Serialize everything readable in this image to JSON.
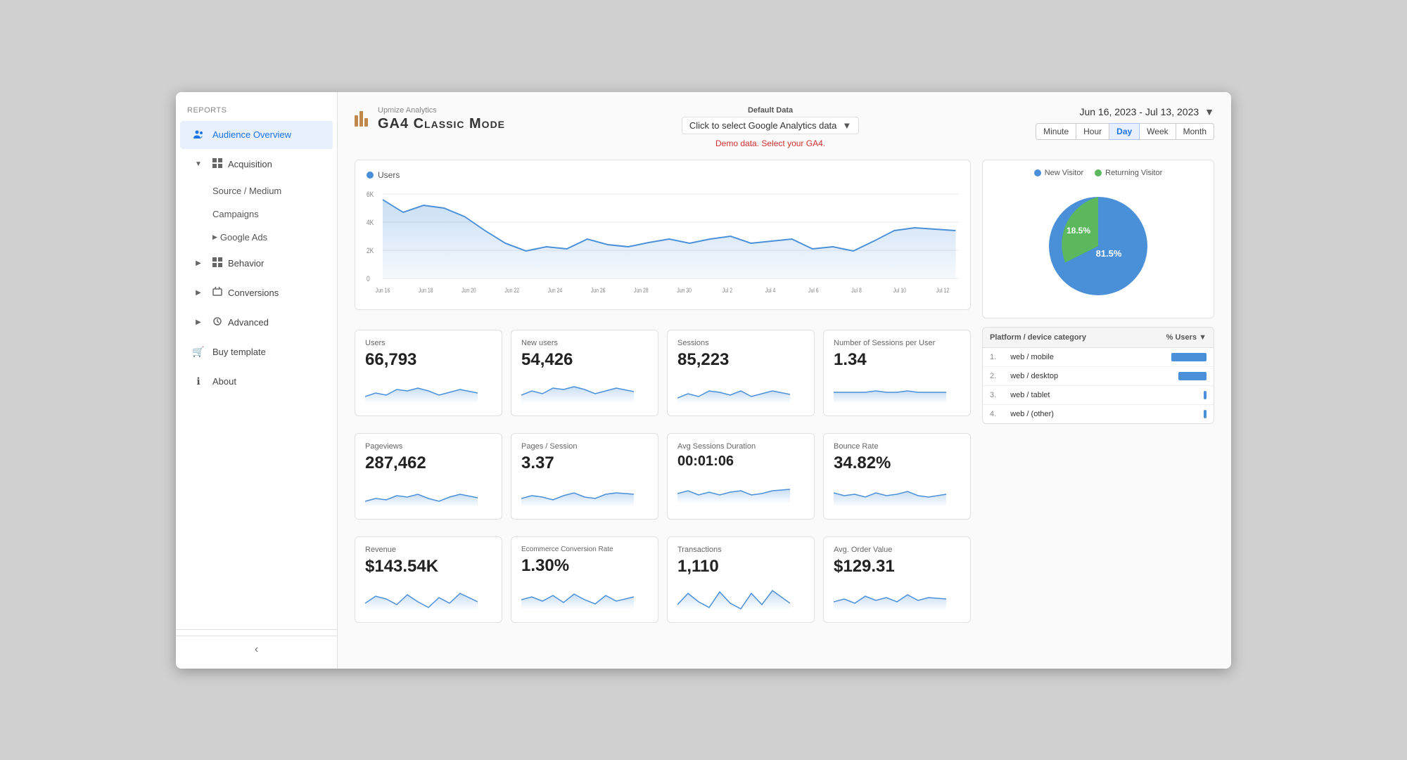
{
  "sidebar": {
    "reports_label": "Reports",
    "items": [
      {
        "id": "audience-overview",
        "label": "Audience Overview",
        "icon": "👤",
        "active": true,
        "level": 0
      },
      {
        "id": "acquisition",
        "label": "Acquisition",
        "icon": "⊞",
        "active": false,
        "level": 0,
        "expanded": true
      },
      {
        "id": "source-medium",
        "label": "Source / Medium",
        "icon": "",
        "active": false,
        "level": 1
      },
      {
        "id": "campaigns",
        "label": "Campaigns",
        "icon": "",
        "active": false,
        "level": 1
      },
      {
        "id": "google-ads",
        "label": "Google Ads",
        "icon": "▶",
        "active": false,
        "level": 1
      },
      {
        "id": "behavior",
        "label": "Behavior",
        "icon": "⊞",
        "active": false,
        "level": 0
      },
      {
        "id": "conversions",
        "label": "Conversions",
        "icon": "⊞",
        "active": false,
        "level": 0
      },
      {
        "id": "advanced",
        "label": "Advanced",
        "icon": "⊞",
        "active": false,
        "level": 0
      },
      {
        "id": "buy-template",
        "label": "Buy template",
        "icon": "🛒",
        "active": false,
        "level": 0
      },
      {
        "id": "about",
        "label": "About",
        "icon": "ℹ",
        "active": false,
        "level": 0
      }
    ],
    "collapse_icon": "‹"
  },
  "header": {
    "logo_subtitle": "Upmize Analytics",
    "logo_title": "GA4 Classic Mode",
    "data_source_label": "Default Data",
    "data_source_sub": "Click to select Google Analytics data",
    "demo_text": "Demo data. Select your GA4.",
    "date_range": "Jun 16, 2023 - Jul 13, 2023",
    "time_buttons": [
      "Minute",
      "Hour",
      "Day",
      "Week",
      "Month"
    ],
    "active_time": "Day"
  },
  "chart": {
    "legend_label": "Users",
    "y_labels": [
      "6K",
      "4K",
      "2K",
      "0"
    ],
    "x_labels": [
      "Jun 16",
      "Jun 18",
      "Jun 20",
      "Jun 22",
      "Jun 24",
      "Jun 26",
      "Jun 28",
      "Jun 30",
      "Jul 2",
      "Jul 4",
      "Jul 6",
      "Jul 8",
      "Jul 10",
      "Jul 12"
    ],
    "data_points": [
      5800,
      4800,
      5200,
      5000,
      4500,
      3600,
      2800,
      2400,
      2600,
      2500,
      2900,
      2700,
      2600,
      2800,
      3000,
      2800,
      3000,
      3200,
      2800,
      2900,
      3000,
      2600,
      2700,
      2400,
      2900,
      3400,
      3500,
      3400
    ]
  },
  "metrics_row1": [
    {
      "id": "users",
      "label": "Users",
      "value": "66,793"
    },
    {
      "id": "new-users",
      "label": "New users",
      "value": "54,426"
    },
    {
      "id": "sessions",
      "label": "Sessions",
      "value": "85,223"
    },
    {
      "id": "sessions-per-user",
      "label": "Number of Sessions per User",
      "value": "1.34"
    }
  ],
  "metrics_row2": [
    {
      "id": "pageviews",
      "label": "Pageviews",
      "value": "287,462"
    },
    {
      "id": "pages-session",
      "label": "Pages / Session",
      "value": "3.37"
    },
    {
      "id": "avg-session-duration",
      "label": "Avg Sessions Duration",
      "value": "00:01:06"
    },
    {
      "id": "bounce-rate",
      "label": "Bounce Rate",
      "value": "34.82%"
    }
  ],
  "metrics_row3": [
    {
      "id": "revenue",
      "label": "Revenue",
      "value": "$143.54K"
    },
    {
      "id": "ecommerce-conversion",
      "label": "Ecommerce Conversion Rate",
      "value": "1.30%"
    },
    {
      "id": "transactions",
      "label": "Transactions",
      "value": "1,110"
    },
    {
      "id": "avg-order-value",
      "label": "Avg. Order Value",
      "value": "$129.31"
    }
  ],
  "pie_chart": {
    "new_visitor_label": "New Visitor",
    "returning_visitor_label": "Returning Visitor",
    "new_visitor_pct": "81.5%",
    "returning_visitor_pct": "18.5%",
    "new_visitor_color": "#4a90d9",
    "returning_visitor_color": "#5cb85c"
  },
  "device_table": {
    "col1": "Platform / device category",
    "col2": "% Users ▼",
    "rows": [
      {
        "num": "1.",
        "name": "web / mobile",
        "pct": "56%",
        "bar": 56
      },
      {
        "num": "2.",
        "name": "web / desktop",
        "pct": "44%",
        "bar": 44
      },
      {
        "num": "3.",
        "name": "web / tablet",
        "pct": "5%",
        "bar": 5
      },
      {
        "num": "4.",
        "name": "web / (other)",
        "pct": "4%",
        "bar": 4
      }
    ]
  }
}
